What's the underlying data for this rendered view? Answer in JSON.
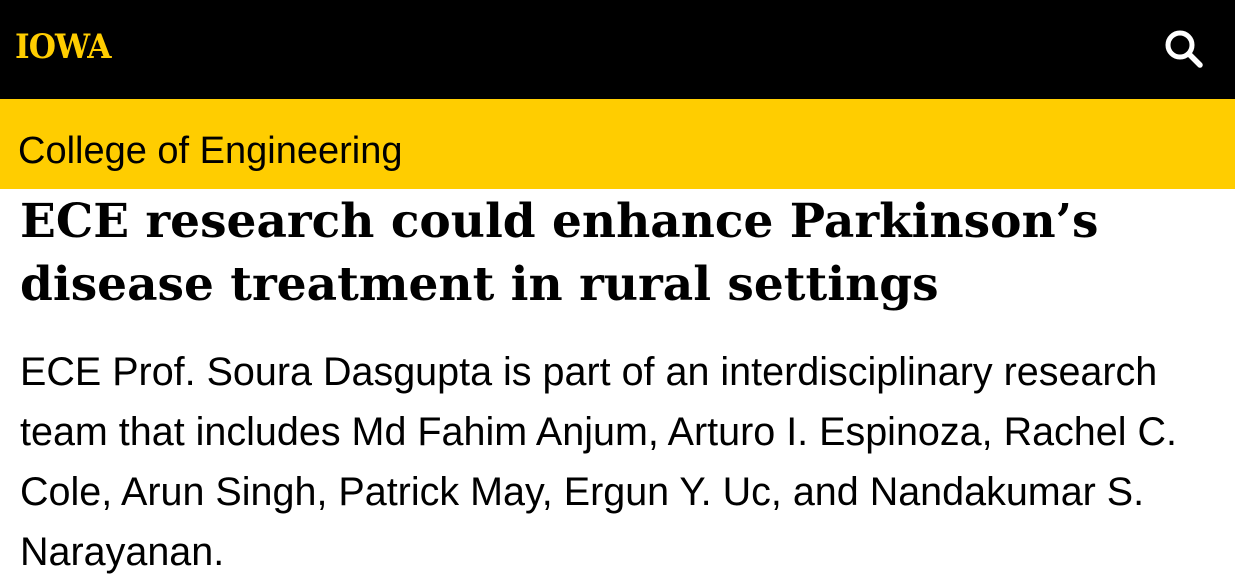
{
  "header": {
    "logo_text": "IOWA",
    "search_icon": "search-icon",
    "background_color": "#000000",
    "accent_color": "#FFCD00"
  },
  "unit_bar": {
    "name": "College of Engineering",
    "background_color": "#FFCD00"
  },
  "article": {
    "title": "ECE research could enhance Parkinson’s disease treatment in rural settings",
    "summary": "ECE Prof. Soura Dasgupta is part of an interdisciplinary research team that includes Md Fahim Anjum, Arturo I. Espinoza, Rachel C. Cole, Arun Singh, Patrick May, Ergun Y. Uc, and Nandakumar S. Narayanan."
  }
}
